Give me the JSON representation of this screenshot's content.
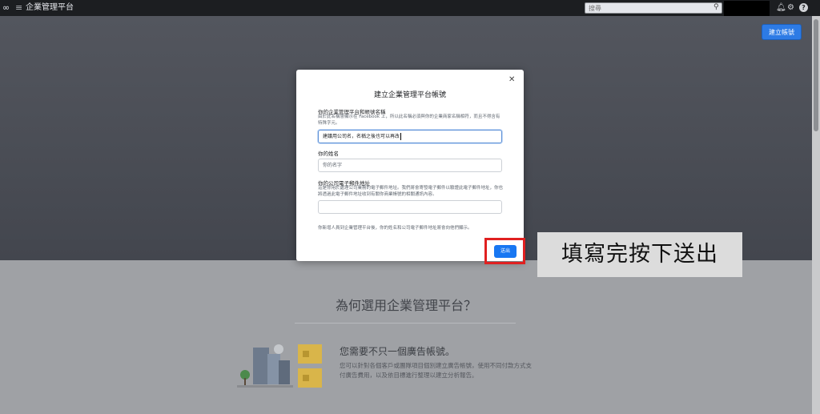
{
  "topbar": {
    "logo": "∞",
    "app_title": "企業管理平台",
    "search_placeholder": "搜尋"
  },
  "hero": {
    "create_button": "建立帳號"
  },
  "modal": {
    "title": "建立企業管理平台帳號",
    "business_name": {
      "label": "你的企業管理平台和帳號名稱",
      "hint": "由於此名稱會顯示在 Facebook 上，所以此名稱必須與你的企業商家名稱相符，而且不得含有特殊字元。",
      "value": "建議用公司名，名稱之後也可以再改"
    },
    "your_name": {
      "label": "你的姓名",
      "placeholder": "你的名字"
    },
    "work_email": {
      "label": "你的公司電子郵件地址",
      "hint": "這是你用於處理公司業務的電子郵件地址。我們將會寄發電子郵件以驗證此電子郵件地址，你也將透過此電子郵件地址收到有關你商業帳號的相關通訊內容。",
      "value": ""
    },
    "footer_note": "你新增人員到企業管理平台後，你的姓名和公司電子郵件地址將會向他們顯示。",
    "submit_button": "送出"
  },
  "annotation": "填寫完按下送出",
  "why_section": {
    "title": "為何選用企業管理平台？",
    "feature_title": "您需要不只一個廣告帳號。",
    "feature_desc": "您可以針對各個客戶或團隊項目個別建立廣告帳號，使用不同付款方式支付廣告費用，以及依目標進行整理以建立分析報告。"
  },
  "colors": {
    "accent": "#1877f2",
    "highlight": "#e02020"
  }
}
